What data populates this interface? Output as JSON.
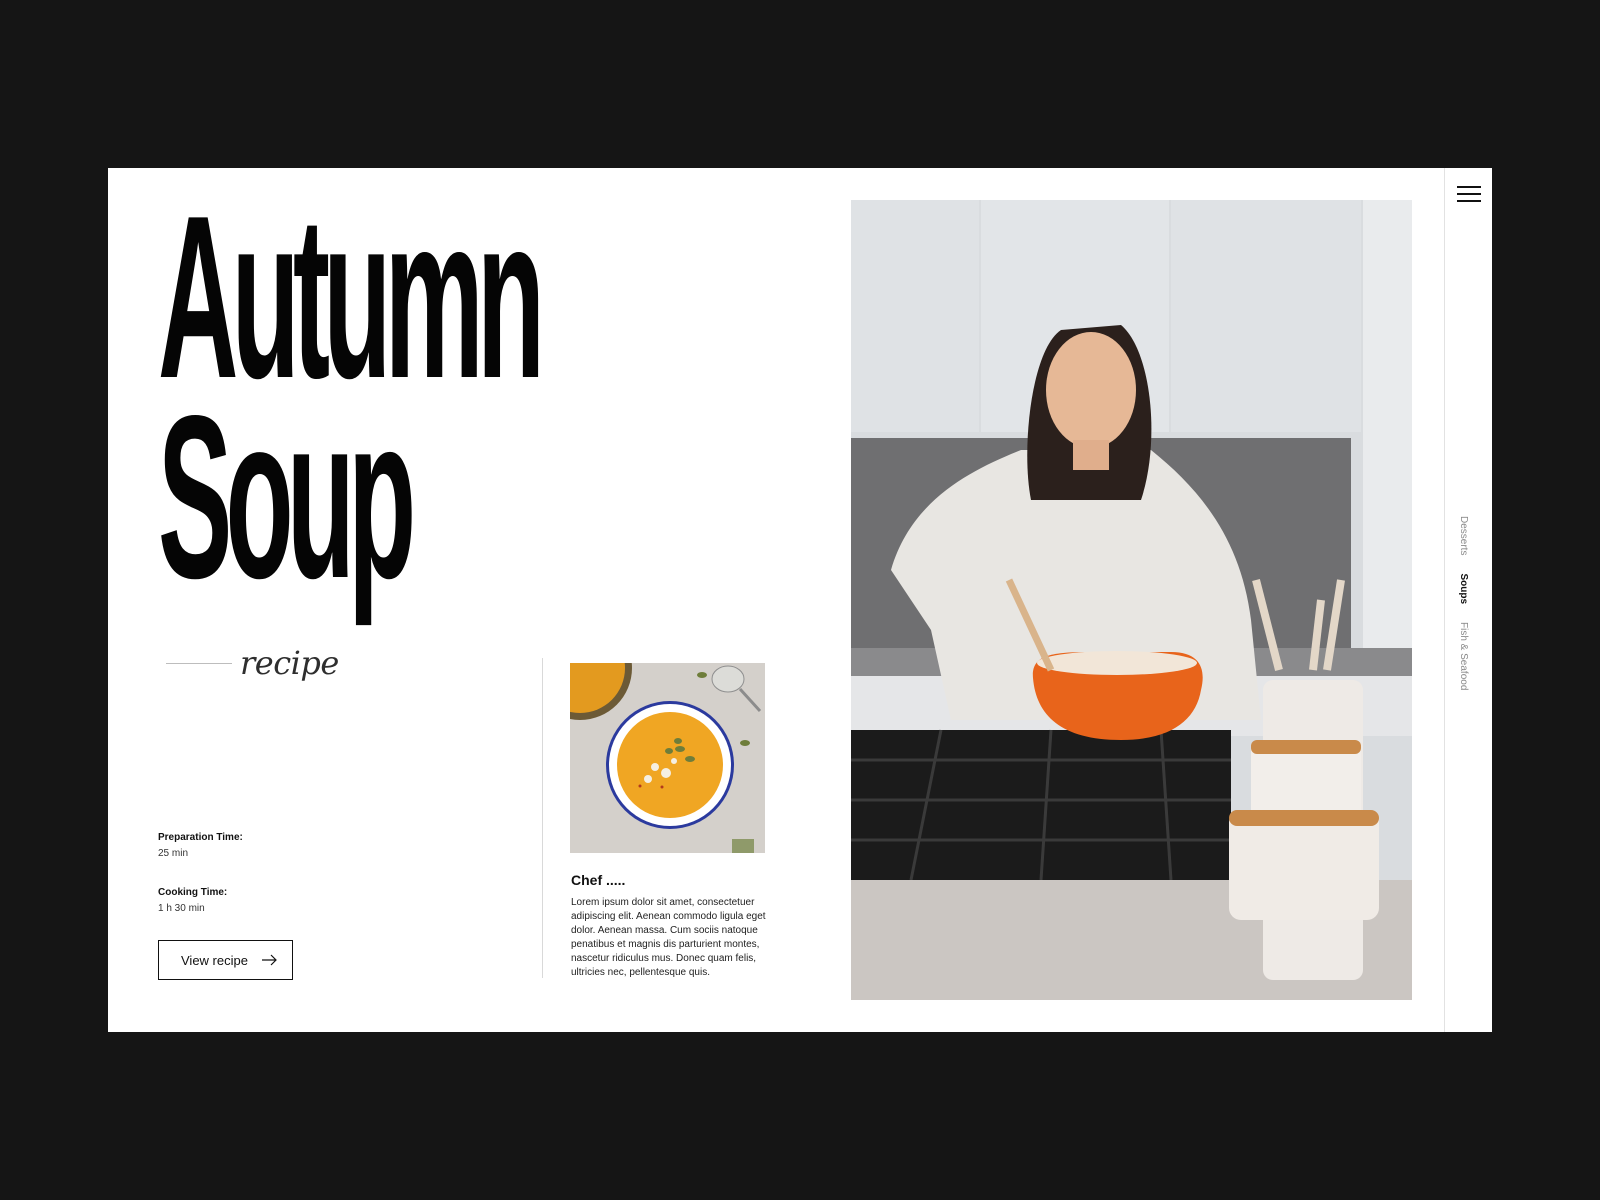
{
  "headline": {
    "line1": "Autumn",
    "line2": "Soup"
  },
  "tag": "recipe",
  "details": {
    "prep_label": "Preparation Time:",
    "prep_value": "25 min",
    "cook_label": "Cooking Time:",
    "cook_value": "1 h 30 min"
  },
  "cta": {
    "label": "View recipe",
    "icon": "arrow-right-icon"
  },
  "chef": {
    "title": "Chef .....",
    "text": "Lorem ipsum dolor sit amet, consectetuer adipiscing elit. Aenean commodo ligula eget dolor. Aenean massa. Cum sociis natoque penatibus et magnis dis parturient montes, nascetur ridiculus mus. Donec quam felis, ultricies nec, pellentesque quis."
  },
  "menu": {
    "icon": "hamburger-menu-icon"
  },
  "categories": [
    {
      "label": "Desserts",
      "active": false
    },
    {
      "label": "Soups",
      "active": true
    },
    {
      "label": "Fish & Seafood",
      "active": false
    }
  ],
  "colors": {
    "background": "#151515",
    "card": "#ffffff",
    "text": "#050505",
    "accent": "#e8641b",
    "soup": "#f0a623"
  }
}
